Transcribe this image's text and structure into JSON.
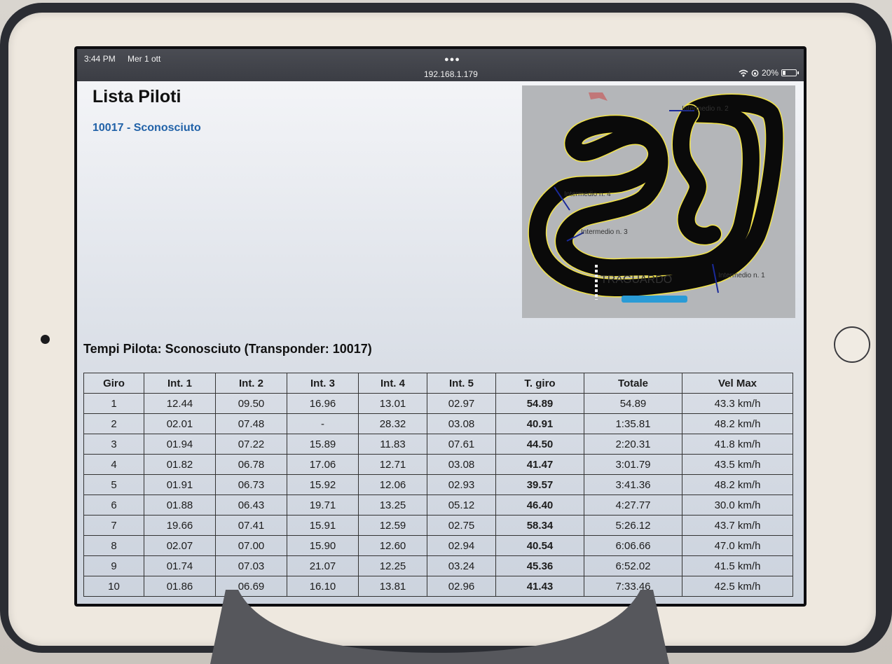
{
  "status_bar": {
    "time": "3:44 PM",
    "date": "Mer 1 ott",
    "url": "192.168.1.179",
    "battery": "20%"
  },
  "page": {
    "title": "Lista Piloti",
    "pilot_link": "10017 - Sconosciuto"
  },
  "track": {
    "labels": [
      "Intermedio n. 2",
      "Intermedio n. 4",
      "Intermedio n. 3",
      "Intermedio n. 1",
      "TRAGUARDO"
    ]
  },
  "times": {
    "title": "Tempi Pilota: Sconosciuto (Transponder: 10017)",
    "headers": [
      "Giro",
      "Int. 1",
      "Int. 2",
      "Int. 3",
      "Int. 4",
      "Int. 5",
      "T. giro",
      "Totale",
      "Vel Max"
    ],
    "rows": [
      [
        "1",
        "12.44",
        "09.50",
        "16.96",
        "13.01",
        "02.97",
        "54.89",
        "54.89",
        "43.3 km/h"
      ],
      [
        "2",
        "02.01",
        "07.48",
        "-",
        "28.32",
        "03.08",
        "40.91",
        "1:35.81",
        "48.2 km/h"
      ],
      [
        "3",
        "01.94",
        "07.22",
        "15.89",
        "11.83",
        "07.61",
        "44.50",
        "2:20.31",
        "41.8 km/h"
      ],
      [
        "4",
        "01.82",
        "06.78",
        "17.06",
        "12.71",
        "03.08",
        "41.47",
        "3:01.79",
        "43.5 km/h"
      ],
      [
        "5",
        "01.91",
        "06.73",
        "15.92",
        "12.06",
        "02.93",
        "39.57",
        "3:41.36",
        "48.2 km/h"
      ],
      [
        "6",
        "01.88",
        "06.43",
        "19.71",
        "13.25",
        "05.12",
        "46.40",
        "4:27.77",
        "30.0 km/h"
      ],
      [
        "7",
        "19.66",
        "07.41",
        "15.91",
        "12.59",
        "02.75",
        "58.34",
        "5:26.12",
        "43.7 km/h"
      ],
      [
        "8",
        "02.07",
        "07.00",
        "15.90",
        "12.60",
        "02.94",
        "40.54",
        "6:06.66",
        "47.0 km/h"
      ],
      [
        "9",
        "01.74",
        "07.03",
        "21.07",
        "12.25",
        "03.24",
        "45.36",
        "6:52.02",
        "41.5 km/h"
      ],
      [
        "10",
        "01.86",
        "06.69",
        "16.10",
        "13.81",
        "02.96",
        "41.43",
        "7:33.46",
        "42.5 km/h"
      ]
    ]
  }
}
